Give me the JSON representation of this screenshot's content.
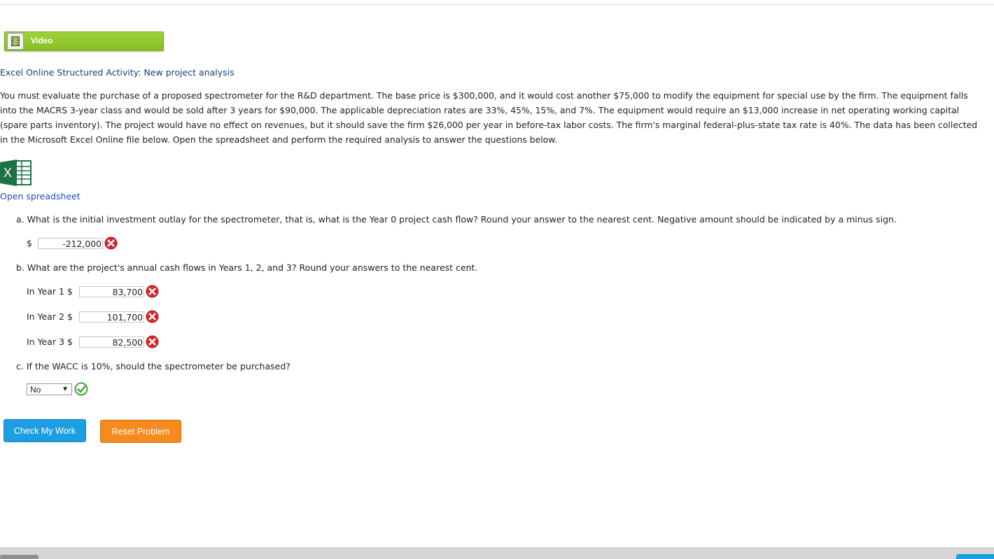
{
  "video": {
    "label": "Video"
  },
  "activity": {
    "title": "Excel Online Structured Activity: New project analysis",
    "description": "You must evaluate the purchase of a proposed spectrometer for the R&D department. The base price is $300,000, and it would cost another $75,000 to modify the equipment for special use by the firm. The equipment falls into the MACRS 3-year class and would be sold after 3 years for $90,000. The applicable depreciation rates are 33%, 45%, 15%, and 7%. The equipment would require an $13,000 increase in net operating working capital (spare parts inventory). The project would have no effect on revenues, but it should save the firm $26,000 per year in before-tax labor costs. The firm's marginal federal-plus-state tax rate is 40%. The data has been collected in the Microsoft Excel Online file below. Open the spreadsheet and perform the required analysis to answer the questions below.",
    "excel_icon_letter": "X",
    "open_link": "Open spreadsheet"
  },
  "question_a": {
    "text": "a. What is the initial investment outlay for the spectrometer, that is, what is the Year 0 project cash flow? Round your answer to the nearest cent. Negative amount should be indicated by a minus sign.",
    "currency": "$",
    "value": "-212,000",
    "status": "incorrect"
  },
  "question_b": {
    "text": "b. What are the project's annual cash flows in Years 1, 2, and 3? Round your answers to the nearest cent.",
    "rows": [
      {
        "label": "In Year 1 $",
        "value": "83,700",
        "status": "incorrect"
      },
      {
        "label": "In Year 2 $",
        "value": "101,700",
        "status": "incorrect"
      },
      {
        "label": "In Year 3 $",
        "value": "82,500",
        "status": "incorrect"
      }
    ]
  },
  "question_c": {
    "text": "c. If the WACC is 10%, should the spectrometer be purchased?",
    "selected": "No",
    "arrow": "▼",
    "status": "correct"
  },
  "buttons": {
    "check": "Check My Work",
    "reset": "Reset Problem"
  },
  "colors": {
    "incorrect": "#d9262e",
    "correct": "#3fa535",
    "check_button": "#1e9ee2",
    "reset_button": "#f58a1f",
    "video_button": "#8cc63f"
  }
}
